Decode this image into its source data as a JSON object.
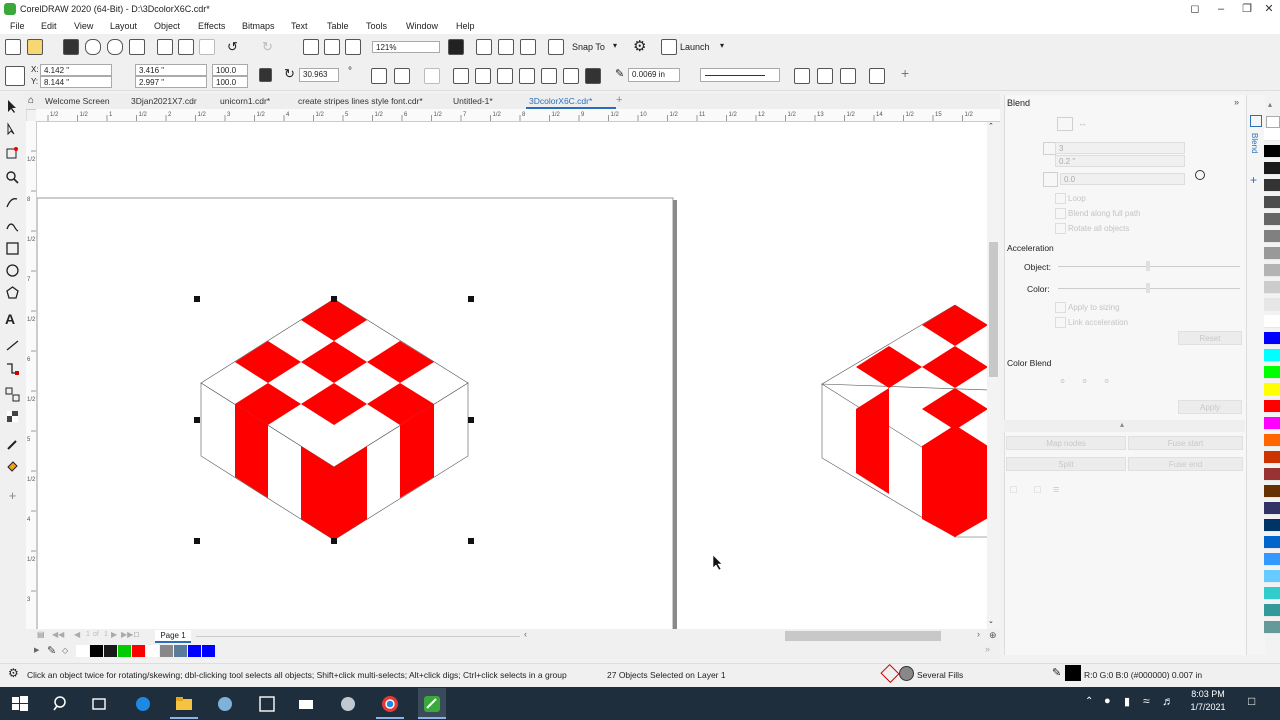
{
  "app": {
    "title": "CorelDRAW 2020 (64-Bit) - D:\\3DcolorX6C.cdr*"
  },
  "menu": [
    "File",
    "Edit",
    "View",
    "Layout",
    "Object",
    "Effects",
    "Bitmaps",
    "Text",
    "Table",
    "Tools",
    "Window",
    "Help"
  ],
  "toolbar": {
    "zoom": "121%",
    "snap_to": "Snap To",
    "launch": "Launch"
  },
  "property_bar": {
    "x": "4.142 \"",
    "y": "8.144 \"",
    "width": "3.416 \"",
    "height": "2.997 \"",
    "scale_w": "100.0",
    "scale_h": "100.0",
    "rotation": "30.963",
    "rotation_unit": "°",
    "outline_width": "0.0069 in"
  },
  "tabs": [
    {
      "label": "Welcome Screen",
      "active": false
    },
    {
      "label": "3Djan2021X7.cdr",
      "active": false
    },
    {
      "label": "unicorn1.cdr*",
      "active": false
    },
    {
      "label": "create stripes lines style font.cdr*",
      "active": false
    },
    {
      "label": "Untitled-1*",
      "active": false
    },
    {
      "label": "3DcolorX6C.cdr*",
      "active": true
    }
  ],
  "ruler": {
    "h_marks": [
      "1/2",
      "1/2",
      "1",
      "1/2",
      "2",
      "1/2",
      "3",
      "1/2",
      "4",
      "1/2",
      "5",
      "1/2",
      "6",
      "1/2",
      "7",
      "1/2",
      "8",
      "1/2",
      "9",
      "1/2",
      "10",
      "1/2",
      "11",
      "1/2",
      "12",
      "1/2",
      "13",
      "1/2",
      "14",
      "1/2",
      "15",
      "1/2"
    ],
    "v_marks": [
      "1/2",
      "8",
      "1/2",
      "7",
      "1/2",
      "6",
      "1/2",
      "5",
      "1/2",
      "4",
      "1/2",
      "3"
    ]
  },
  "blend_panel": {
    "title": "Blend",
    "side_tab": "Blend",
    "steps": "3",
    "spacing": "0.2 \"",
    "rotation": "0.0",
    "options": [
      "Loop",
      "Blend along full path",
      "Rotate all objects"
    ],
    "acceleration_heading": "Acceleration",
    "object_label": "Object:",
    "color_label": "Color:",
    "accel_options": [
      "Apply to sizing",
      "Link acceleration"
    ],
    "reset": "Reset",
    "color_blend_heading": "Color Blend",
    "apply": "Apply",
    "map_nodes": "Map nodes",
    "fuse_start": "Fuse start",
    "split": "Split",
    "fuse_end": "Fuse end"
  },
  "document": {
    "page_label": "Page 1",
    "page_count": "1",
    "page_of": "of"
  },
  "status": {
    "hint": "Click an object twice for rotating/skewing; dbl-clicking tool selects all objects; Shift+click multi-selects; Alt+click digs; Ctrl+click selects in a group",
    "selection": "27 Objects Selected on Layer 1",
    "fill": "Several Fills",
    "outline": "R:0 G:0 B:0 (#000000)  0.007 in"
  },
  "taskbar": {
    "time": "8:03 PM",
    "date": "1/7/2021"
  },
  "colors": {
    "red": "#ff0000",
    "accent": "#2a6ebb",
    "taskbar": "#1f2e3c"
  },
  "palette_colors": [
    "#ffffff",
    "#000000",
    "#1a1a1a",
    "#333333",
    "#4d4d4d",
    "#666666",
    "#808080",
    "#999999",
    "#b3b3b3",
    "#cccccc",
    "#e6e6e6",
    "#ffffff",
    "#0000ff",
    "#00ffff",
    "#00ff00",
    "#ffff00",
    "#ff0000",
    "#ff00ff",
    "#ff6600",
    "#cc3300",
    "#993333",
    "#663300",
    "#333366",
    "#003366",
    "#0066cc",
    "#3399ff",
    "#66ccff",
    "#33cccc",
    "#339999",
    "#669999"
  ],
  "docbar_swatches": [
    "#ffffff",
    "#000000",
    "#1a1a1a",
    "#00cc00",
    "#ff0000",
    "#ffffff",
    "#888888",
    "#5b7b9b",
    "#0000ff",
    "#0000ff"
  ]
}
